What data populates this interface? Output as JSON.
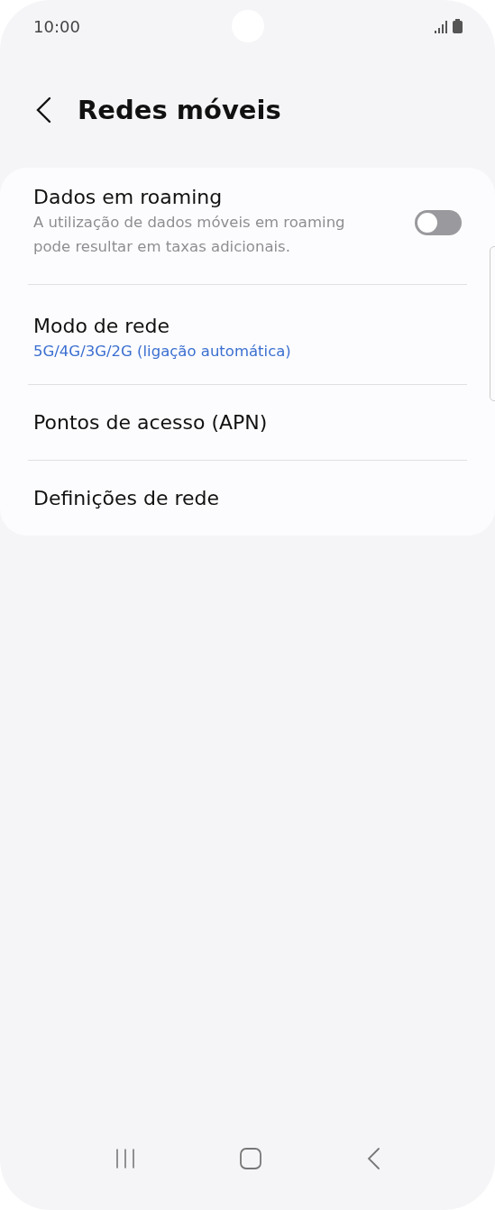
{
  "status_bar": {
    "time": "10:00"
  },
  "header": {
    "title": "Redes móveis"
  },
  "settings": [
    {
      "kind": "toggle",
      "title": "Dados em roaming",
      "summary": "A utilização de dados móveis em roaming pode resultar em taxas adicionais.",
      "on": false
    },
    {
      "kind": "value",
      "title": "Modo de rede",
      "value": "5G/4G/3G/2G (ligação automática)"
    },
    {
      "kind": "link",
      "title": "Pontos de acesso (APN)"
    },
    {
      "kind": "link",
      "title": "Definições de rede"
    }
  ]
}
